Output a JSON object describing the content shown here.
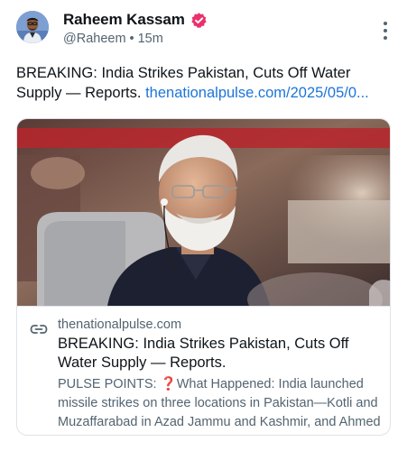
{
  "author": {
    "name": "Raheem Kassam",
    "handle": "@Raheem",
    "separator": "•",
    "time": "15m",
    "verified_color": "#e8336d"
  },
  "post": {
    "text": "BREAKING: India Strikes Pakistan, Cuts Off Water Supply — Reports.",
    "link_text": "thenationalpulse.com/2025/05/0...",
    "link_color": "#1d74d8"
  },
  "card": {
    "domain": "thenationalpulse.com",
    "title": "BREAKING: India Strikes Pakistan, Cuts Off Water Supply — Reports.",
    "description_prefix": "PULSE POINTS: ",
    "description_emoji": "❓",
    "description": "What Happened: India launched missile strikes on three locations in Pakistan—Kotli and Muzaffarabad in Azad Jammu and Kashmir, and Ahmed"
  },
  "icons": {
    "verified": "verified-badge-icon",
    "more": "more-vertical-icon",
    "link": "link-icon"
  }
}
